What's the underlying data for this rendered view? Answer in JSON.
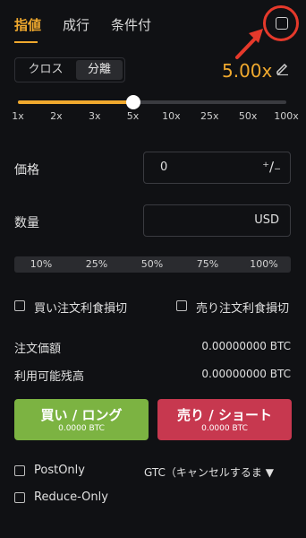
{
  "tabs": [
    {
      "label": "指値",
      "active": true
    },
    {
      "label": "成行",
      "active": false
    },
    {
      "label": "条件付",
      "active": false
    }
  ],
  "calculator_icon": "calculator-icon",
  "annotation": {
    "color": "#e5392b"
  },
  "margin_mode": {
    "cross": "クロス",
    "isolated": "分離",
    "selected": "分離"
  },
  "leverage": {
    "value": "5.00x",
    "edit_icon": "pencil-icon"
  },
  "slider": {
    "ticks": [
      "1x",
      "2x",
      "3x",
      "5x",
      "10x",
      "25x",
      "50x",
      "100x"
    ],
    "selected": "5x"
  },
  "price": {
    "label": "価格",
    "value": "0",
    "adjust_icon": "plus-minus-icon"
  },
  "quantity": {
    "label": "数量",
    "unit": "USD"
  },
  "percentages": [
    "10%",
    "25%",
    "50%",
    "75%",
    "100%"
  ],
  "tp_sl": {
    "buy": "買い注文利食損切",
    "sell": "売り注文利食損切"
  },
  "order_value": {
    "label": "注文価額",
    "value": "0.00000000 BTC"
  },
  "available": {
    "label": "利用可能残高",
    "value": "0.00000000 BTC"
  },
  "buy_button": {
    "label": "買い / ロング",
    "sub": "0.0000 BTC",
    "color": "#7cb342"
  },
  "sell_button": {
    "label": "売り / ショート",
    "sub": "0.0000 BTC",
    "color": "#c7384f"
  },
  "post_only": {
    "label": "PostOnly"
  },
  "reduce_only": {
    "label": "Reduce-Only"
  },
  "time_in_force": {
    "label": "GTC（キャンセルするま ▼"
  },
  "colors": {
    "accent": "#f0a92e",
    "background": "#101114"
  }
}
